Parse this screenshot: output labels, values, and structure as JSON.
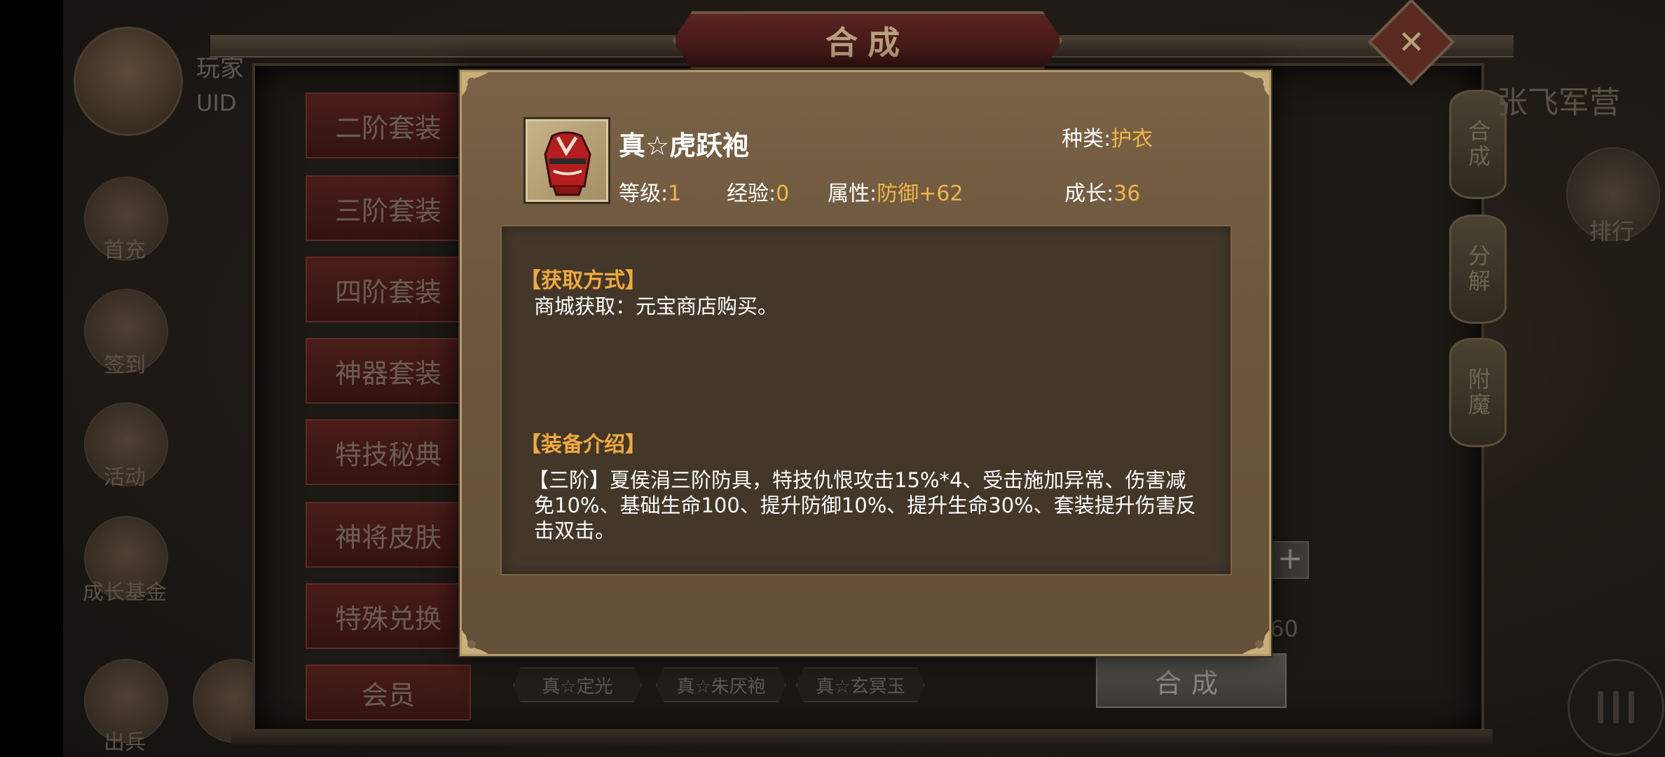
{
  "header": {
    "title": "合成"
  },
  "player": {
    "name": "玩家",
    "uid": "UID"
  },
  "left_menu": [
    {
      "label": "首充"
    },
    {
      "label": "签到"
    },
    {
      "label": "活动"
    },
    {
      "label": "成长基金"
    },
    {
      "label": "出兵"
    }
  ],
  "categories": [
    {
      "label": "二阶套装"
    },
    {
      "label": "三阶套装"
    },
    {
      "label": "四阶套装"
    },
    {
      "label": "神器套装"
    },
    {
      "label": "特技秘典"
    },
    {
      "label": "神将皮肤"
    },
    {
      "label": "特殊兑换"
    },
    {
      "label": "会员"
    }
  ],
  "right_tabs": [
    {
      "label": "合成"
    },
    {
      "label": "分解"
    },
    {
      "label": "附魔"
    }
  ],
  "right_panel": {
    "camp": "张飞军营",
    "rank_label": "排行",
    "plus": "+",
    "count": "60",
    "compose_button": "合成"
  },
  "bottom_tags": [
    {
      "label": "真☆定光"
    },
    {
      "label": "真☆朱厌袍"
    },
    {
      "label": "真☆玄冥玉"
    }
  ],
  "item": {
    "name": "真☆虎跃袍",
    "type_label": "种类:",
    "type_value": "护衣",
    "level_label": "等级:",
    "level_value": "1",
    "exp_label": "经验:",
    "exp_value": "0",
    "attr_label": "属性:",
    "attr_value": "防御+62",
    "growth_label": "成长:",
    "growth_value": "36",
    "acquire_title": "【获取方式】",
    "acquire_text": "商城获取：元宝商店购买。",
    "intro_title": "【装备介绍】",
    "intro_text": "【三阶】夏侯涓三阶防具，特技仇恨攻击15%*4、受击施加异常、伤害减免10%、基础生命100、提升防御10%、提升生命30%、套装提升伤害反击双击。"
  },
  "colors": {
    "value_gold": "#f0b64a",
    "section_orange": "#f0a93e",
    "popup_bg": "#6c563d",
    "panel_bg": "#43372a"
  }
}
